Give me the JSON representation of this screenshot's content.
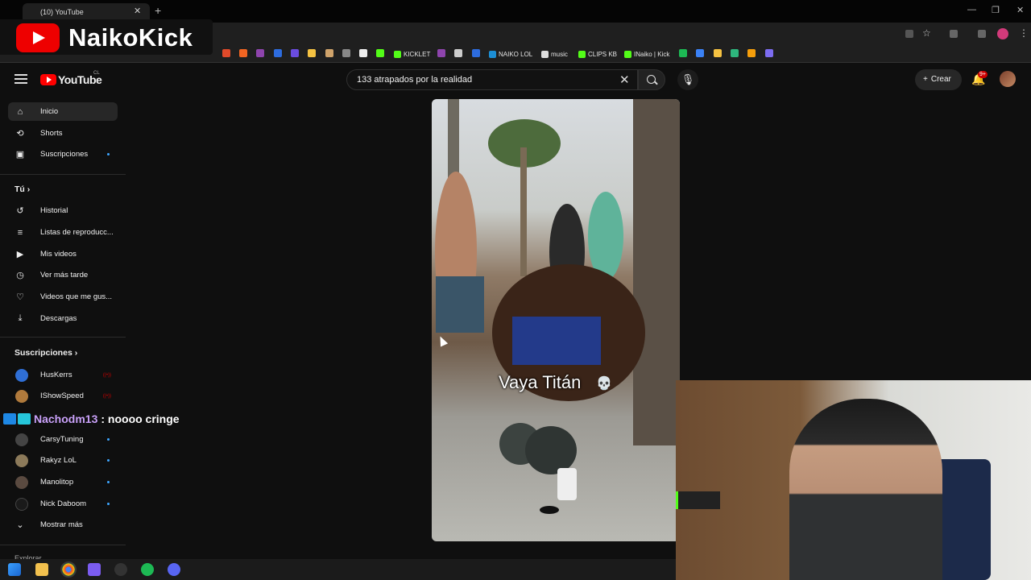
{
  "browser": {
    "tab_title": "(10) YouTube",
    "close": "✕",
    "new_tab": "+",
    "window_controls": [
      "—",
      "❐",
      "✕"
    ],
    "bookmarks": [
      "KICKLET",
      "NAIKO LOL",
      "music",
      "CLIPS KB",
      "INaiko | Kick"
    ]
  },
  "overlay": {
    "streamer_name": "NaikoKick"
  },
  "header": {
    "logo_text": "YouTube",
    "country_code": "CL",
    "search_value": "133 atrapados por la realidad",
    "create_label": "Crear",
    "notifications_badge": "9+"
  },
  "sidebar": {
    "main": [
      {
        "label": "Inicio",
        "icon": "home-icon",
        "glyph": "⌂"
      },
      {
        "label": "Shorts",
        "icon": "shorts-icon",
        "glyph": "⟲"
      },
      {
        "label": "Suscripciones",
        "icon": "subscriptions-icon",
        "glyph": "▣"
      }
    ],
    "you_heading": "Tú",
    "you_chevron": "›",
    "you": [
      {
        "label": "Historial",
        "icon": "history-icon",
        "glyph": "↺"
      },
      {
        "label": "Listas de reproducc...",
        "icon": "playlists-icon",
        "glyph": "≡"
      },
      {
        "label": "Mis videos",
        "icon": "my-videos-icon",
        "glyph": "▶"
      },
      {
        "label": "Ver más tarde",
        "icon": "watch-later-icon",
        "glyph": "◷"
      },
      {
        "label": "Videos que me gus...",
        "icon": "liked-icon",
        "glyph": "♡"
      },
      {
        "label": "Descargas",
        "icon": "downloads-icon",
        "glyph": "⤓"
      }
    ],
    "subs_heading": "Suscripciones",
    "channels": [
      {
        "name": "HusKerrs",
        "color": "#2f6fd6"
      },
      {
        "name": "IShowSpeed",
        "color": "#b07a3c"
      },
      {
        "name": "CarsyTuning",
        "color": "#444444"
      },
      {
        "name": "Rakyz LoL",
        "color": "#8c7a5a"
      },
      {
        "name": "Manolitop",
        "color": "#5a4a40"
      },
      {
        "name": "Nick Daboom",
        "color": "#1a1a1a"
      }
    ],
    "show_more": "Mostrar más",
    "explore": "Explorar"
  },
  "chat": {
    "user": "Nachodm13",
    "message": ": noooo cringe"
  },
  "video": {
    "caption": "Vaya Titán",
    "caption_emoji": "💀"
  },
  "colors": {
    "youtube_red": "#ff0000",
    "accent_blue": "#3ea6ff",
    "background": "#0f0f0f"
  }
}
